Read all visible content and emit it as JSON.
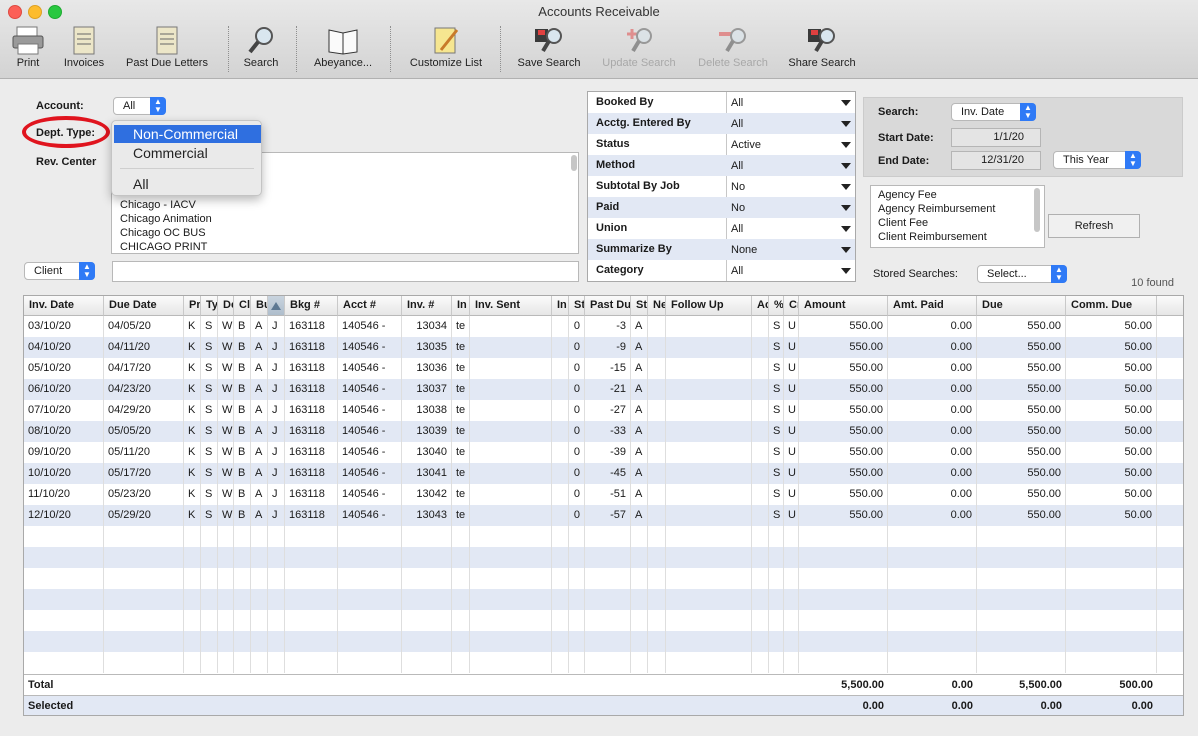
{
  "window": {
    "title": "Accounts Receivable"
  },
  "toolbar": {
    "print": "Print",
    "invoices": "Invoices",
    "past_due": "Past Due Letters",
    "search": "Search",
    "abeyance": "Abeyance...",
    "customize": "Customize List",
    "save_search": "Save Search",
    "update_search": "Update Search",
    "delete_search": "Delete Search",
    "share_search": "Share Search"
  },
  "form": {
    "account_label": "Account:",
    "account_value": "All",
    "dept_type_label": "Dept. Type:",
    "rev_center_label": "Rev. Center",
    "rev_centers": [
      "Chicago - IACV",
      "Chicago Animation",
      "Chicago OC BUS",
      "CHICAGO PRINT"
    ],
    "client_popup": "Client",
    "client_text": ""
  },
  "dept_menu": {
    "items": [
      "Non-Commercial",
      "Commercial",
      "All"
    ],
    "selected": "Non-Commercial"
  },
  "filters": [
    {
      "label": "Booked By",
      "value": "All"
    },
    {
      "label": "Acctg. Entered By",
      "value": "All"
    },
    {
      "label": "Status",
      "value": "Active"
    },
    {
      "label": "Method",
      "value": "All"
    },
    {
      "label": "Subtotal By Job",
      "value": "No"
    },
    {
      "label": "Paid",
      "value": "No"
    },
    {
      "label": "Union",
      "value": "All"
    },
    {
      "label": "Summarize By",
      "value": "None"
    },
    {
      "label": "Category",
      "value": "All"
    }
  ],
  "search_panel": {
    "search_label": "Search:",
    "search_value": "Inv. Date",
    "start_label": "Start Date:",
    "start_value": "1/1/20",
    "end_label": "End Date:",
    "end_value": "12/31/20",
    "range_value": "This Year",
    "fee_types": [
      "Agency Fee",
      "Agency Reimbursement",
      "Client Fee",
      "Client Reimbursement"
    ],
    "refresh": "Refresh",
    "stored_label": "Stored Searches:",
    "stored_value": "Select...",
    "found": "10 found"
  },
  "table": {
    "headers": [
      "Inv. Date",
      "Due Date",
      "Pr",
      "Ty",
      "De",
      "Cl",
      "Bu",
      "",
      "Bkg #",
      "Acct #",
      "Inv. #",
      "In",
      "Inv. Sent",
      "In",
      "St",
      "Past Du",
      "St",
      "Ne",
      "Follow Up",
      "Ac",
      "%",
      "Cr",
      "Amount",
      "Amt. Paid",
      "Due",
      "Comm. Due"
    ],
    "rows": [
      [
        "03/10/20",
        "04/05/20",
        "K",
        "S",
        "W",
        "B",
        "A",
        "J",
        "163118",
        "140546 -",
        "13034",
        "te",
        "",
        "",
        "0",
        "-3",
        "A",
        "",
        "",
        "",
        "S",
        "U",
        "550.00",
        "0.00",
        "550.00",
        "50.00"
      ],
      [
        "04/10/20",
        "04/11/20",
        "K",
        "S",
        "W",
        "B",
        "A",
        "J",
        "163118",
        "140546 -",
        "13035",
        "te",
        "",
        "",
        "0",
        "-9",
        "A",
        "",
        "",
        "",
        "S",
        "U",
        "550.00",
        "0.00",
        "550.00",
        "50.00"
      ],
      [
        "05/10/20",
        "04/17/20",
        "K",
        "S",
        "W",
        "B",
        "A",
        "J",
        "163118",
        "140546 -",
        "13036",
        "te",
        "",
        "",
        "0",
        "-15",
        "A",
        "",
        "",
        "",
        "S",
        "U",
        "550.00",
        "0.00",
        "550.00",
        "50.00"
      ],
      [
        "06/10/20",
        "04/23/20",
        "K",
        "S",
        "W",
        "B",
        "A",
        "J",
        "163118",
        "140546 -",
        "13037",
        "te",
        "",
        "",
        "0",
        "-21",
        "A",
        "",
        "",
        "",
        "S",
        "U",
        "550.00",
        "0.00",
        "550.00",
        "50.00"
      ],
      [
        "07/10/20",
        "04/29/20",
        "K",
        "S",
        "W",
        "B",
        "A",
        "J",
        "163118",
        "140546 -",
        "13038",
        "te",
        "",
        "",
        "0",
        "-27",
        "A",
        "",
        "",
        "",
        "S",
        "U",
        "550.00",
        "0.00",
        "550.00",
        "50.00"
      ],
      [
        "08/10/20",
        "05/05/20",
        "K",
        "S",
        "W",
        "B",
        "A",
        "J",
        "163118",
        "140546 -",
        "13039",
        "te",
        "",
        "",
        "0",
        "-33",
        "A",
        "",
        "",
        "",
        "S",
        "U",
        "550.00",
        "0.00",
        "550.00",
        "50.00"
      ],
      [
        "09/10/20",
        "05/11/20",
        "K",
        "S",
        "W",
        "B",
        "A",
        "J",
        "163118",
        "140546 -",
        "13040",
        "te",
        "",
        "",
        "0",
        "-39",
        "A",
        "",
        "",
        "",
        "S",
        "U",
        "550.00",
        "0.00",
        "550.00",
        "50.00"
      ],
      [
        "10/10/20",
        "05/17/20",
        "K",
        "S",
        "W",
        "B",
        "A",
        "J",
        "163118",
        "140546 -",
        "13041",
        "te",
        "",
        "",
        "0",
        "-45",
        "A",
        "",
        "",
        "",
        "S",
        "U",
        "550.00",
        "0.00",
        "550.00",
        "50.00"
      ],
      [
        "11/10/20",
        "05/23/20",
        "K",
        "S",
        "W",
        "B",
        "A",
        "J",
        "163118",
        "140546 -",
        "13042",
        "te",
        "",
        "",
        "0",
        "-51",
        "A",
        "",
        "",
        "",
        "S",
        "U",
        "550.00",
        "0.00",
        "550.00",
        "50.00"
      ],
      [
        "12/10/20",
        "05/29/20",
        "K",
        "S",
        "W",
        "B",
        "A",
        "J",
        "163118",
        "140546 -",
        "13043",
        "te",
        "",
        "",
        "0",
        "-57",
        "A",
        "",
        "",
        "",
        "S",
        "U",
        "550.00",
        "0.00",
        "550.00",
        "50.00"
      ]
    ],
    "total": {
      "label": "Total",
      "amount": "5,500.00",
      "paid": "0.00",
      "due": "5,500.00",
      "comm": "500.00"
    },
    "selected": {
      "label": "Selected",
      "amount": "0.00",
      "paid": "0.00",
      "due": "0.00",
      "comm": "0.00"
    }
  },
  "colors": {
    "accent": "#2f7af6",
    "row_alt": "#e2e8f4",
    "highlight_circle": "#e0141e"
  }
}
